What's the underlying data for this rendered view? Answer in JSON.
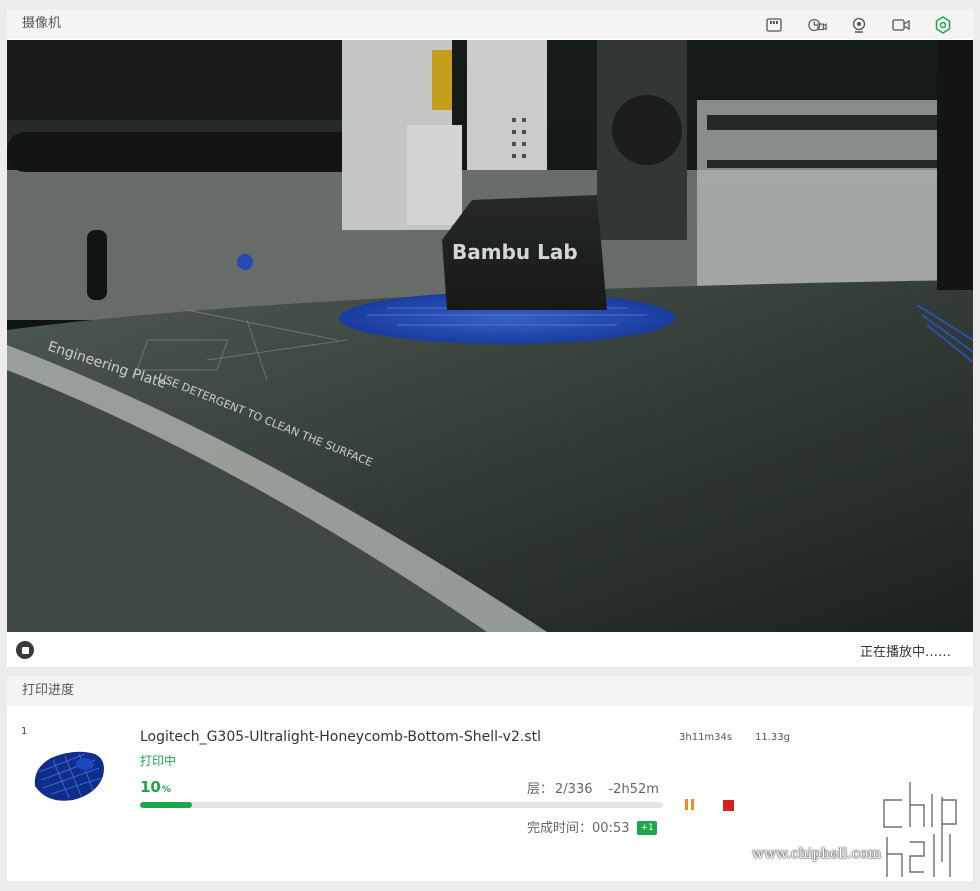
{
  "camera": {
    "title": "摄像机",
    "toolbar_icons": [
      "sd-card-icon",
      "timelapse-camera-icon",
      "webcam-icon",
      "video-record-icon",
      "settings-icon"
    ],
    "playing_status": "正在播放中……",
    "feed_brand_text": "Bambu Lab",
    "plate_text_1": "Engineering Plate",
    "plate_text_2": "USE DETERGENT TO CLEAN THE SURFACE"
  },
  "progress": {
    "title": "打印进度",
    "job": {
      "index": "1",
      "filename": "Logitech_G305-Ultralight-Honeycomb-Bottom-Shell-v2.stl",
      "status": "打印中",
      "percent_value": "10",
      "percent_sign": "%",
      "progress_fraction": 0.1,
      "layer_label": "层：",
      "layer_value": "2/336",
      "remaining": "-2h52m",
      "finish_label": "完成时间：",
      "finish_time": "00:53",
      "finish_day_offset": "+1",
      "total_time": "3h11m34s",
      "weight": "11.33g"
    }
  },
  "watermark": {
    "url": "www.chiphell.com",
    "logo_text": "chip hell"
  },
  "colors": {
    "accent_green": "#1fa64a",
    "pause_orange": "#f08a24",
    "stop_red": "#d62020"
  }
}
